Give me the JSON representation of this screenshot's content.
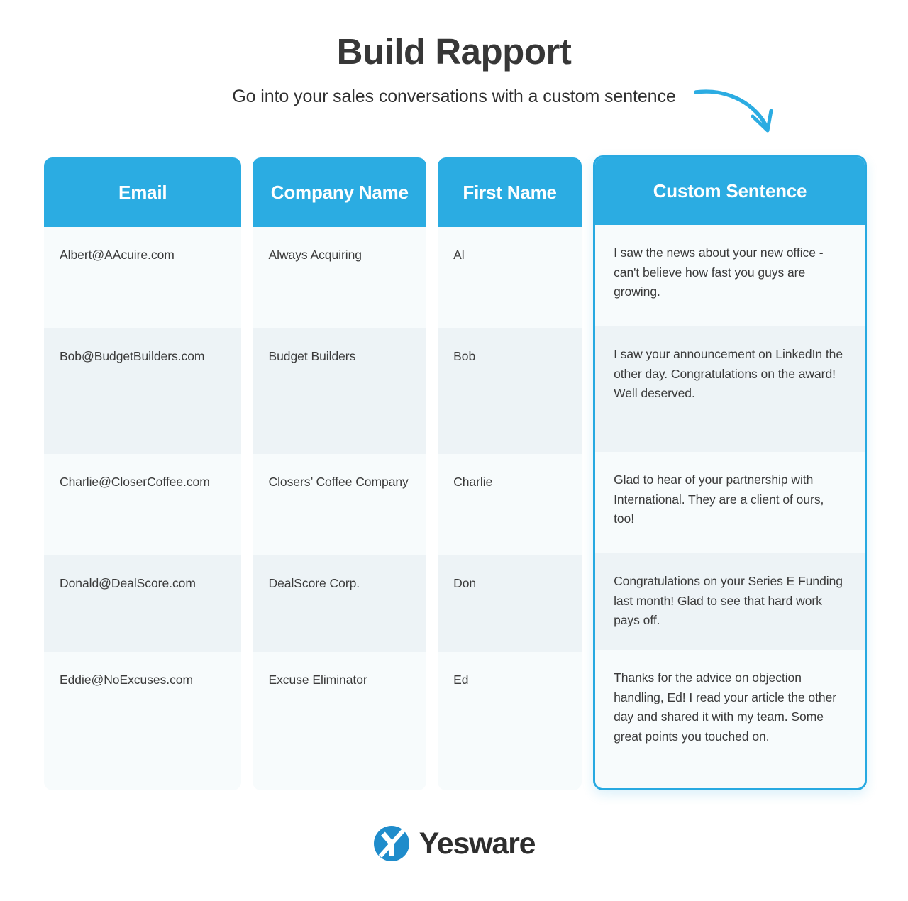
{
  "header": {
    "title": "Build Rapport",
    "subtitle": "Go into your sales conversations with a custom sentence",
    "arrow_icon": "curved-arrow-down-right-icon",
    "accent_color": "#2BACE2"
  },
  "table": {
    "columns": [
      {
        "key": "email",
        "label": "Email",
        "highlighted": false
      },
      {
        "key": "company",
        "label": "Company Name",
        "highlighted": false
      },
      {
        "key": "first_name",
        "label": "First Name",
        "highlighted": false
      },
      {
        "key": "custom_sentence",
        "label": "Custom Sentence",
        "highlighted": true
      }
    ],
    "rows": [
      {
        "email": "Albert@AAcuire.com",
        "company": "Always Acquiring",
        "first_name": "Al",
        "custom_sentence": "I saw the news about your new office - can't believe how fast you guys are growing."
      },
      {
        "email": "Bob@BudgetBuilders.com",
        "company": "Budget Builders",
        "first_name": "Bob",
        "custom_sentence": "I saw your announcement on LinkedIn the other day. Congratulations on the award! Well deserved."
      },
      {
        "email": "Charlie@CloserCoffee.com",
        "company": "Closers’ Coffee Company",
        "first_name": "Charlie",
        "custom_sentence": "Glad to hear of your partnership with International. They are a client of ours, too!"
      },
      {
        "email": "Donald@DealScore.com",
        "company": "DealScore Corp.",
        "first_name": "Don",
        "custom_sentence": "Congratulations on your Series E Funding last month! Glad to see that hard work pays off."
      },
      {
        "email": "Eddie@NoExcuses.com",
        "company": "Excuse Eliminator",
        "first_name": "Ed",
        "custom_sentence": "Thanks for the advice on objection handling, Ed! I read your article the other day and shared it with my team. Some great points you touched on."
      }
    ]
  },
  "footer": {
    "brand_name": "Yesware",
    "logo_icon": "yesware-logo-icon",
    "logo_color": "#1F8CCB"
  }
}
